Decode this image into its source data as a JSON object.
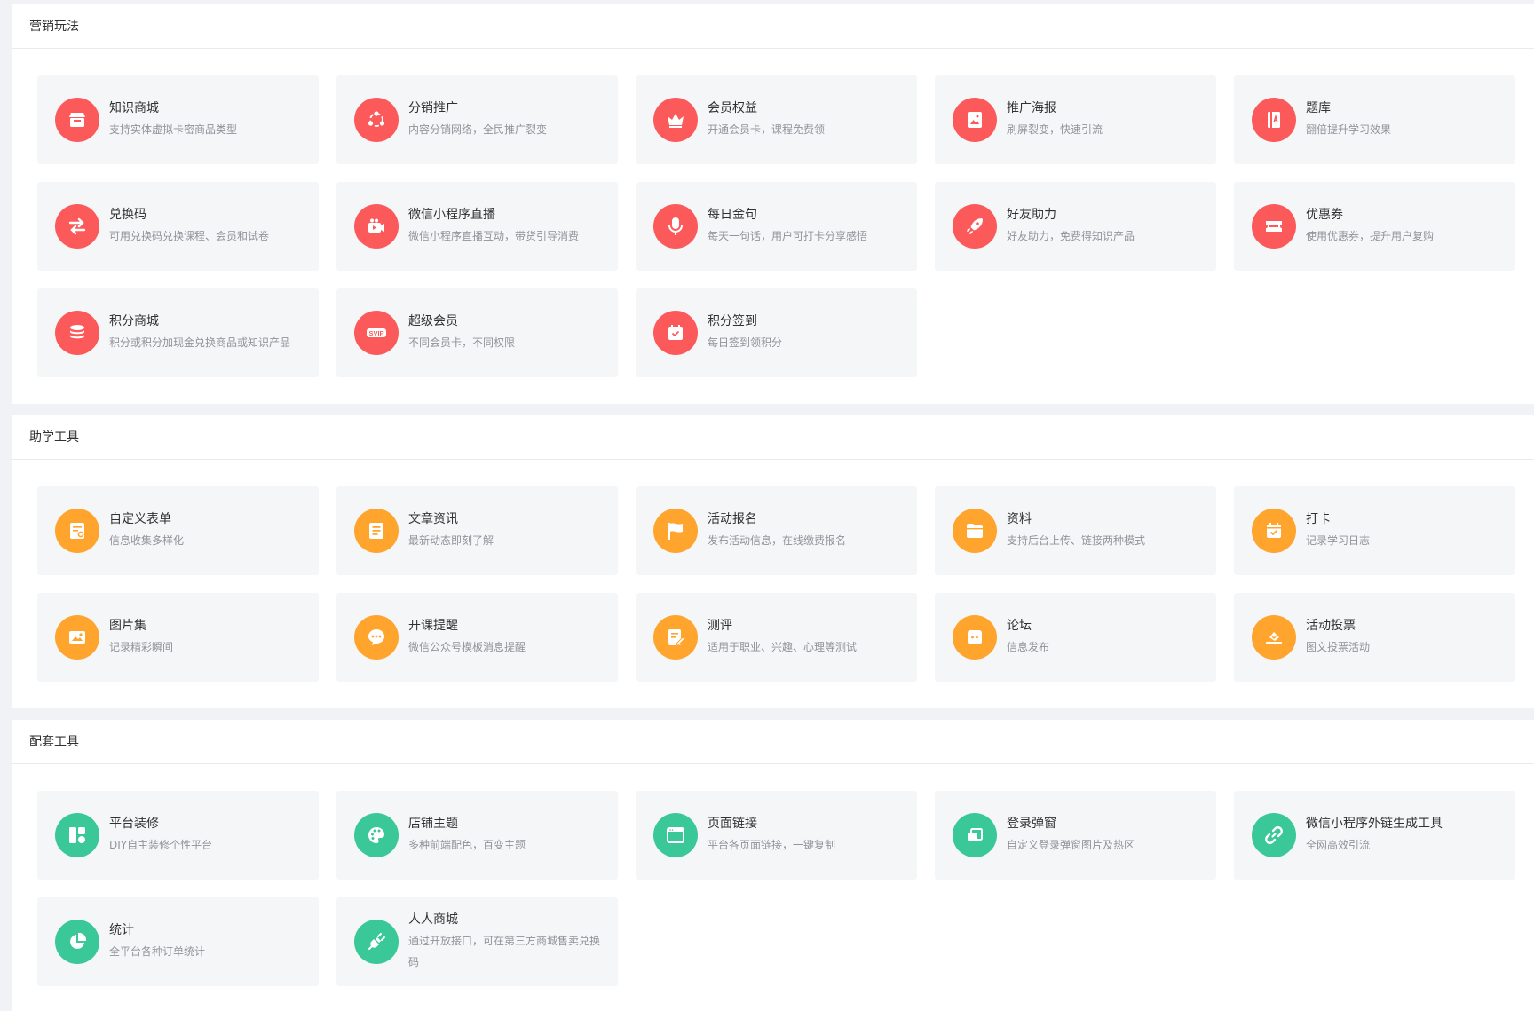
{
  "colors": {
    "marketing": "#fc5a5a",
    "study": "#ffa42d",
    "support": "#3ac898"
  },
  "sections": [
    {
      "title": "营销玩法",
      "items": [
        {
          "title": "知识商城",
          "desc": "支持实体虚拟卡密商品类型",
          "icon": "store-icon"
        },
        {
          "title": "分销推广",
          "desc": "内容分销网络，全民推广裂变",
          "icon": "share-network-icon"
        },
        {
          "title": "会员权益",
          "desc": "开通会员卡，课程免费领",
          "icon": "crown-icon"
        },
        {
          "title": "推广海报",
          "desc": "刷屏裂变，快速引流",
          "icon": "poster-icon"
        },
        {
          "title": "题库",
          "desc": "翻倍提升学习效果",
          "icon": "question-bank-icon"
        },
        {
          "title": "兑换码",
          "desc": "可用兑换码兑换课程、会员和试卷",
          "icon": "exchange-icon"
        },
        {
          "title": "微信小程序直播",
          "desc": "微信小程序直播互动，带货引导消费",
          "icon": "live-video-icon"
        },
        {
          "title": "每日金句",
          "desc": "每天一句话，用户可打卡分享感悟",
          "icon": "microphone-icon"
        },
        {
          "title": "好友助力",
          "desc": "好友助力，免费得知识产品",
          "icon": "rocket-icon"
        },
        {
          "title": "优惠券",
          "desc": "使用优惠券，提升用户复购",
          "icon": "coupon-icon"
        },
        {
          "title": "积分商城",
          "desc": "积分或积分加现金兑换商品或知识产品",
          "icon": "coins-icon"
        },
        {
          "title": "超级会员",
          "desc": "不同会员卡，不同权限",
          "icon": "svip-icon"
        },
        {
          "title": "积分签到",
          "desc": "每日签到领积分",
          "icon": "calendar-check-icon"
        }
      ]
    },
    {
      "title": "助学工具",
      "items": [
        {
          "title": "自定义表单",
          "desc": "信息收集多样化",
          "icon": "form-icon"
        },
        {
          "title": "文章资讯",
          "desc": "最新动态即刻了解",
          "icon": "article-icon"
        },
        {
          "title": "活动报名",
          "desc": "发布活动信息，在线缴费报名",
          "icon": "flag-icon"
        },
        {
          "title": "资料",
          "desc": "支持后台上传、链接两种模式",
          "icon": "folder-icon"
        },
        {
          "title": "打卡",
          "desc": "记录学习日志",
          "icon": "checkin-calendar-icon"
        },
        {
          "title": "图片集",
          "desc": "记录精彩瞬间",
          "icon": "image-icon"
        },
        {
          "title": "开课提醒",
          "desc": "微信公众号模板消息提醒",
          "icon": "chat-bubble-icon"
        },
        {
          "title": "测评",
          "desc": "适用于职业、兴趣、心理等测试",
          "icon": "edit-doc-icon"
        },
        {
          "title": "论坛",
          "desc": "信息发布",
          "icon": "forum-icon"
        },
        {
          "title": "活动投票",
          "desc": "图文投票活动",
          "icon": "vote-icon"
        }
      ]
    },
    {
      "title": "配套工具",
      "items": [
        {
          "title": "平台装修",
          "desc": "DIY自主装修个性平台",
          "icon": "layout-icon"
        },
        {
          "title": "店铺主题",
          "desc": "多种前端配色，百变主题",
          "icon": "palette-icon"
        },
        {
          "title": "页面链接",
          "desc": "平台各页面链接，一键复制",
          "icon": "browser-window-icon"
        },
        {
          "title": "登录弹窗",
          "desc": "自定义登录弹窗图片及热区",
          "icon": "popup-icon"
        },
        {
          "title": "微信小程序外链生成工具",
          "desc": "全网高效引流",
          "icon": "link-icon"
        },
        {
          "title": "统计",
          "desc": "全平台各种订单统计",
          "icon": "pie-chart-icon"
        },
        {
          "title": "人人商城",
          "desc": "通过开放接口，可在第三方商城售卖兑换码",
          "icon": "plug-icon"
        }
      ]
    }
  ]
}
